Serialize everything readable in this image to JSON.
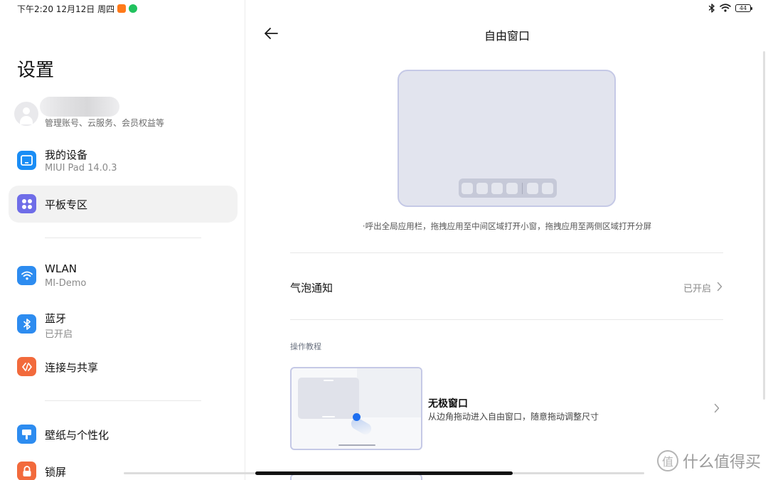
{
  "status_bar": {
    "time_date": "下午2:20 12月12日 周四",
    "left_app_icons": [
      "taobao-icon",
      "phone-call-icon"
    ],
    "right_icons": [
      "bluetooth-icon",
      "wifi-icon",
      "battery-icon"
    ],
    "battery_level": "44"
  },
  "sidebar": {
    "title": "设置",
    "account": {
      "subtitle": "管理账号、云服务、会员权益等"
    },
    "items": [
      {
        "label": "我的设备",
        "subtitle": "MIUI Pad 14.0.3",
        "icon": "tablet-icon",
        "icon_color": "#1a8df5"
      },
      {
        "label": "平板专区",
        "subtitle": "",
        "icon": "grid-dots-icon",
        "icon_color": "#6f6de8",
        "active": true
      },
      {
        "label": "WLAN",
        "subtitle": "MI-Demo",
        "icon": "wifi-icon",
        "icon_color": "#2d8cf0"
      },
      {
        "label": "蓝牙",
        "subtitle": "已开启",
        "icon": "bluetooth-icon",
        "icon_color": "#2d8cf0"
      },
      {
        "label": "连接与共享",
        "subtitle": "",
        "icon": "share-icon",
        "icon_color": "#f26a3c"
      },
      {
        "label": "壁纸与个性化",
        "subtitle": "",
        "icon": "wallpaper-icon",
        "icon_color": "#2d8cf0"
      },
      {
        "label": "锁屏",
        "subtitle": "",
        "icon": "lock-icon",
        "icon_color": "#f26a3c"
      }
    ]
  },
  "main": {
    "title": "自由窗口",
    "illustration_caption": "·呼出全局应用栏，拖拽应用至中间区域打开小窗，拖拽应用至两侧区域打开分屏",
    "bubble_setting": {
      "label": "气泡通知",
      "value": "已开启"
    },
    "section_header": "操作教程",
    "tutorial": {
      "title": "无极窗口",
      "description": "从边角拖动进入自由窗口，随意拖动调整尺寸"
    }
  },
  "watermark": {
    "logo_glyph": "值",
    "text": "什么值得买"
  }
}
